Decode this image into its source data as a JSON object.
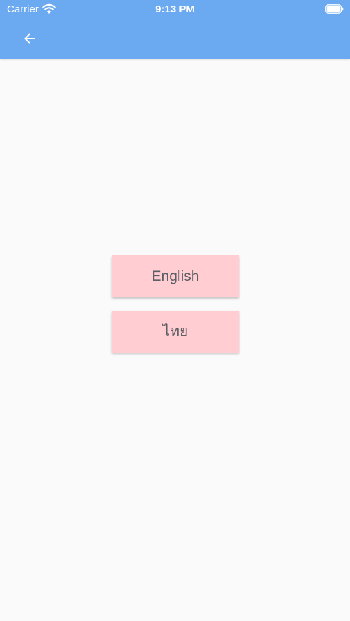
{
  "status_bar": {
    "carrier": "Carrier",
    "time": "9:13 PM",
    "wifi_icon": "wifi-icon",
    "battery_icon": "battery-icon"
  },
  "app_bar": {
    "color": "#6ba9f0",
    "back_icon": "arrow-back-icon"
  },
  "content": {
    "background": "#fafafa",
    "buttons": [
      {
        "label": "English",
        "color": "#ffcdd2"
      },
      {
        "label": "ไทย",
        "color": "#ffcdd2"
      }
    ]
  }
}
